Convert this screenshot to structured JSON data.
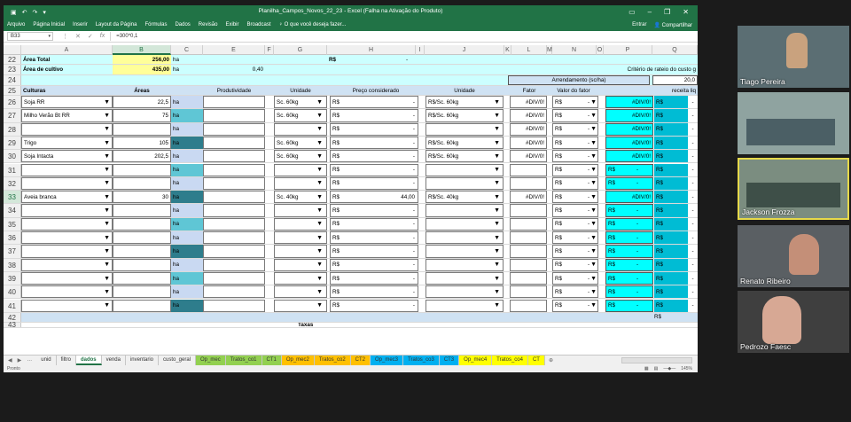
{
  "window": {
    "title": "Planilha_Campos_Novos_22_23 - Excel (Falha na Ativação do Produto)"
  },
  "ribbon_tabs": [
    "Arquivo",
    "Página Inicial",
    "Inserir",
    "Layout da Página",
    "Fórmulas",
    "Dados",
    "Revisão",
    "Exibir",
    "Broadcast",
    "♀ O que você deseja fazer..."
  ],
  "ribbon_right": {
    "login": "Entrar",
    "share": "Compartilhar"
  },
  "formula_bar": {
    "name_box": "B33",
    "formula": "=300*0,1"
  },
  "columns": [
    "A",
    "B",
    "C",
    "E",
    "F",
    "G",
    "H",
    "I",
    "J",
    "K",
    "L",
    "M",
    "N",
    "O",
    "P",
    "Q"
  ],
  "rows": {
    "r22": {
      "num": "22",
      "a": "Área Total",
      "b": "256,00",
      "c": "ha",
      "h": "R$",
      "i": "-"
    },
    "r23": {
      "num": "23",
      "a": "Área de cultivo",
      "b": "435,00",
      "c": "ha",
      "e": "0,40",
      "q": "Critério de rateio do custo g"
    },
    "r24": {
      "num": "24",
      "n": "Arrendamento (sc/ha)",
      "q": "20,0"
    },
    "r25": {
      "num": "25",
      "a": "Culturas",
      "b": "Áreas",
      "e": "Produtividade",
      "g": "Unidade",
      "h": "Preço considerado",
      "j": "Unidade",
      "l": "Fator",
      "n": "Valor do fator",
      "q": "receita liq"
    },
    "r26": {
      "num": "26",
      "a": "Soja RR",
      "b": "22,5",
      "c": "ha",
      "g": "Sc. 60kg",
      "h": "R$",
      "i": "-",
      "j": "R$/Sc. 60kg",
      "l": "#DIV/0!",
      "n": "R$",
      "o": "-",
      "p": "#DIV/0!",
      "q": "R$"
    },
    "r27": {
      "num": "27",
      "a": "Milho Verão Bt RR",
      "b": "75",
      "c": "ha",
      "g": "Sc. 60kg",
      "h": "R$",
      "i": "-",
      "j": "R$/Sc. 60kg",
      "l": "#DIV/0!",
      "n": "R$",
      "o": "-",
      "p": "#DIV/0!",
      "q": "R$"
    },
    "r28": {
      "num": "28",
      "c": "ha",
      "h": "R$",
      "i": "-",
      "l": "#DIV/0!",
      "n": "R$",
      "o": "-",
      "p": "#DIV/0!",
      "q": "R$"
    },
    "r29": {
      "num": "29",
      "a": "Trigo",
      "b": "105",
      "c": "ha",
      "g": "Sc. 60kg",
      "h": "R$",
      "i": "-",
      "j": "R$/Sc. 60kg",
      "l": "#DIV/0!",
      "n": "R$",
      "o": "-",
      "p": "#DIV/0!",
      "q": "R$"
    },
    "r30": {
      "num": "30",
      "a": "Soja Intacta",
      "b": "202,5",
      "c": "ha",
      "g": "Sc. 60kg",
      "h": "R$",
      "i": "-",
      "j": "R$/Sc. 60kg",
      "l": "#DIV/0!",
      "n": "R$",
      "o": "-",
      "p": "#DIV/0!",
      "q": "R$"
    },
    "r31": {
      "num": "31",
      "c": "ha",
      "h": "R$",
      "i": "-",
      "n": "R$",
      "o": "-",
      "p": "R$",
      "p2": "-",
      "q": "R$"
    },
    "r32": {
      "num": "32",
      "c": "ha",
      "h": "R$",
      "i": "-",
      "n": "R$",
      "o": "-",
      "p": "R$",
      "p2": "-",
      "q": "R$"
    },
    "r33": {
      "num": "33",
      "a": "Aveia branca",
      "b": "30",
      "c": "ha",
      "g": "Sc. 40kg",
      "h": "R$",
      "i": "44,00",
      "j": "R$/Sc. 40kg",
      "l": "#DIV/0!",
      "n": "R$",
      "o": "-",
      "p": "#DIV/0!",
      "q": "R$"
    },
    "r34": {
      "num": "34",
      "c": "ha",
      "h": "R$",
      "i": "-",
      "n": "R$",
      "o": "-",
      "p": "R$",
      "p2": "-",
      "q": "R$"
    },
    "r35": {
      "num": "35",
      "c": "ha",
      "h": "R$",
      "i": "-",
      "n": "R$",
      "o": "-",
      "p": "R$",
      "p2": "-",
      "q": "R$"
    },
    "r36": {
      "num": "36",
      "c": "ha",
      "h": "R$",
      "i": "-",
      "n": "R$",
      "o": "-",
      "p": "R$",
      "p2": "-",
      "q": "R$"
    },
    "r37": {
      "num": "37",
      "c": "ha",
      "h": "R$",
      "i": "-",
      "n": "R$",
      "o": "-",
      "p": "R$",
      "p2": "-",
      "q": "R$"
    },
    "r38": {
      "num": "38",
      "c": "ha",
      "h": "R$",
      "i": "-",
      "n": "R$",
      "o": "-",
      "p": "R$",
      "p2": "-",
      "q": "R$"
    },
    "r39": {
      "num": "39",
      "c": "ha",
      "h": "R$",
      "i": "-",
      "n": "R$",
      "o": "-",
      "p": "R$",
      "p2": "-",
      "q": "R$"
    },
    "r40": {
      "num": "40",
      "c": "ha",
      "h": "R$",
      "i": "-",
      "n": "R$",
      "o": "-",
      "p": "R$",
      "p2": "-",
      "q": "R$"
    },
    "r41": {
      "num": "41",
      "c": "ha",
      "h": "R$",
      "i": "-",
      "n": "R$",
      "o": "-",
      "p": "R$",
      "p2": "-",
      "q": "R$"
    },
    "r42": {
      "num": "42",
      "q": "R$"
    },
    "r43": {
      "num": "43",
      "h": "Taxas"
    }
  },
  "sheet_tabs": [
    "unid",
    "filtro",
    "dados",
    "venda",
    "inventario",
    "custo_geral",
    "Op_mec",
    "Tratos_co1",
    "CT1",
    "Op_mec2",
    "Tratos_co2",
    "CT2",
    "Op_mec3",
    "Tratos_co3",
    "CT3",
    "Op_mec4",
    "Tratos_co4",
    "CT"
  ],
  "tab_colors": [
    "#f0f0f0",
    "#f0f0f0",
    "#ffffff",
    "#f0f0f0",
    "#f0f0f0",
    "#f0f0f0",
    "#92d050",
    "#92d050",
    "#92d050",
    "#ffc000",
    "#ffc000",
    "#ffc000",
    "#00b0f0",
    "#00b0f0",
    "#00b0f0",
    "#ffff00",
    "#ffff00",
    "#ffff00"
  ],
  "active_tab": "dados",
  "status": {
    "mode": "Pronto",
    "zoom": "145%"
  },
  "participants": [
    {
      "name": "Tiago Pereira"
    },
    {
      "name": ""
    },
    {
      "name": "Jackson Frozza"
    },
    {
      "name": "Renato Ribeiro"
    },
    {
      "name": "Pedrozo Faesc"
    }
  ],
  "colors": {
    "excel_green": "#217346",
    "cyan": "#00ffff",
    "teal": "#00bcd4",
    "yellow_cell": "#ffff99"
  }
}
